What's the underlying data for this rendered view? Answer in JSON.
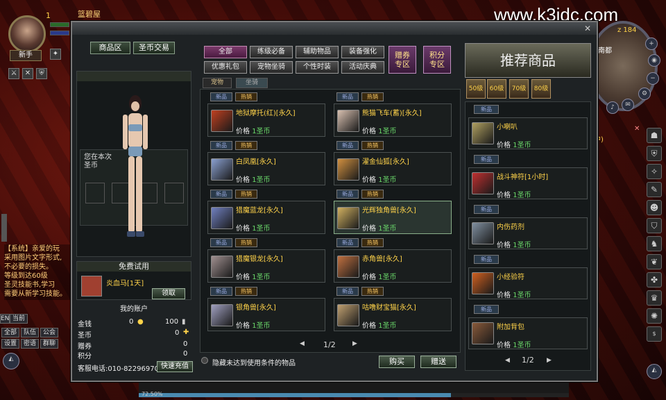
{
  "watermark": "www.k3idc.com",
  "player": {
    "level": "1",
    "title": "新手",
    "name_bar": "篮碧屋"
  },
  "minimap": {
    "coord": "z 184",
    "place": "南都",
    "status": "行中)"
  },
  "chat": {
    "lines": [
      "【系统】亲爱的玩",
      "采用图片文字形式,",
      "不必要的损失。",
      "    等级到达60级",
      "圣灵技能书,学习",
      "需要从新学习技能。"
    ],
    "tabs": [
      "全部",
      "队伍",
      "公会",
      "设置",
      "密语",
      "群聊"
    ],
    "channel": [
      "EN",
      "当前"
    ]
  },
  "shop": {
    "top_buttons": {
      "mall": "商品区",
      "trade": "圣币交易"
    },
    "categories": [
      "全部",
      "练级必备",
      "辅助物品",
      "装备强化",
      "优惠礼包",
      "宠物坐骑",
      "个性时装",
      "活动庆典"
    ],
    "special": [
      {
        "l1": "赠券",
        "l2": "专区"
      },
      {
        "l1": "积分",
        "l2": "专区"
      }
    ],
    "subtabs": [
      "宠物",
      "坐骑"
    ],
    "tag_new": "新品",
    "tag_hot": "热销",
    "price_label": "价格",
    "currency": "圣币",
    "items": [
      {
        "name": "地狱摩托(红)[永久]",
        "price": "1",
        "color": "#c04020"
      },
      {
        "name": "熊猫飞车(蓄)[永久]",
        "price": "1",
        "color": "#d8c0b0"
      },
      {
        "name": "白凤凰[永久]",
        "price": "1",
        "color": "#8aa0d0"
      },
      {
        "name": "濯金仙狐[永久]",
        "price": "1",
        "color": "#d09040"
      },
      {
        "name": "猎魔蓝龙[永久]",
        "price": "1",
        "color": "#7080c0"
      },
      {
        "name": "光辉独角兽[永久]",
        "price": "1",
        "color": "#d0b060"
      },
      {
        "name": "猎魔银龙[永久]",
        "price": "1",
        "color": "#a09090"
      },
      {
        "name": "赤角兽[永久]",
        "price": "1",
        "color": "#c07040"
      },
      {
        "name": "银角兽[永久]",
        "price": "1",
        "color": "#a0a0c0"
      },
      {
        "name": "咕噜财宝猫[永久]",
        "price": "1",
        "color": "#c0a070"
      }
    ],
    "pager": "1/2",
    "hide_unusable": "隐藏未达到使用条件的物品",
    "buy": "购买",
    "gift": "赠送"
  },
  "preview": {
    "notice": "您在本次",
    "notice2": "圣币",
    "free_trial": "免费试用",
    "trial_item": "炎血马[1天]",
    "claim": "领取"
  },
  "account": {
    "title": "我的账户",
    "rows": [
      {
        "label": "金钱",
        "v1": "0",
        "v2": "100"
      },
      {
        "label": "圣币",
        "v1": "",
        "v2": "0"
      },
      {
        "label": "赠券",
        "v1": "",
        "v2": "0"
      },
      {
        "label": "积分",
        "v1": "",
        "v2": "0"
      }
    ],
    "hotline": "客服电话:010-82296970",
    "recharge": "快速充值"
  },
  "recommend": {
    "title": "推荐商品",
    "levels": [
      "50级",
      "60级",
      "70级",
      "80级"
    ],
    "items": [
      {
        "name": "小喇叭",
        "price": "1",
        "color": "#b0a060"
      },
      {
        "name": "战斗神符[1小时]",
        "price": "1",
        "color": "#c03030"
      },
      {
        "name": "内伤药剂",
        "price": "1",
        "color": "#8090a0"
      },
      {
        "name": "小经验符",
        "price": "1",
        "color": "#d06020"
      },
      {
        "name": "附加背包",
        "price": "1",
        "color": "#8a5a3a"
      }
    ],
    "pager": "1/2"
  },
  "exp": "72.50%"
}
